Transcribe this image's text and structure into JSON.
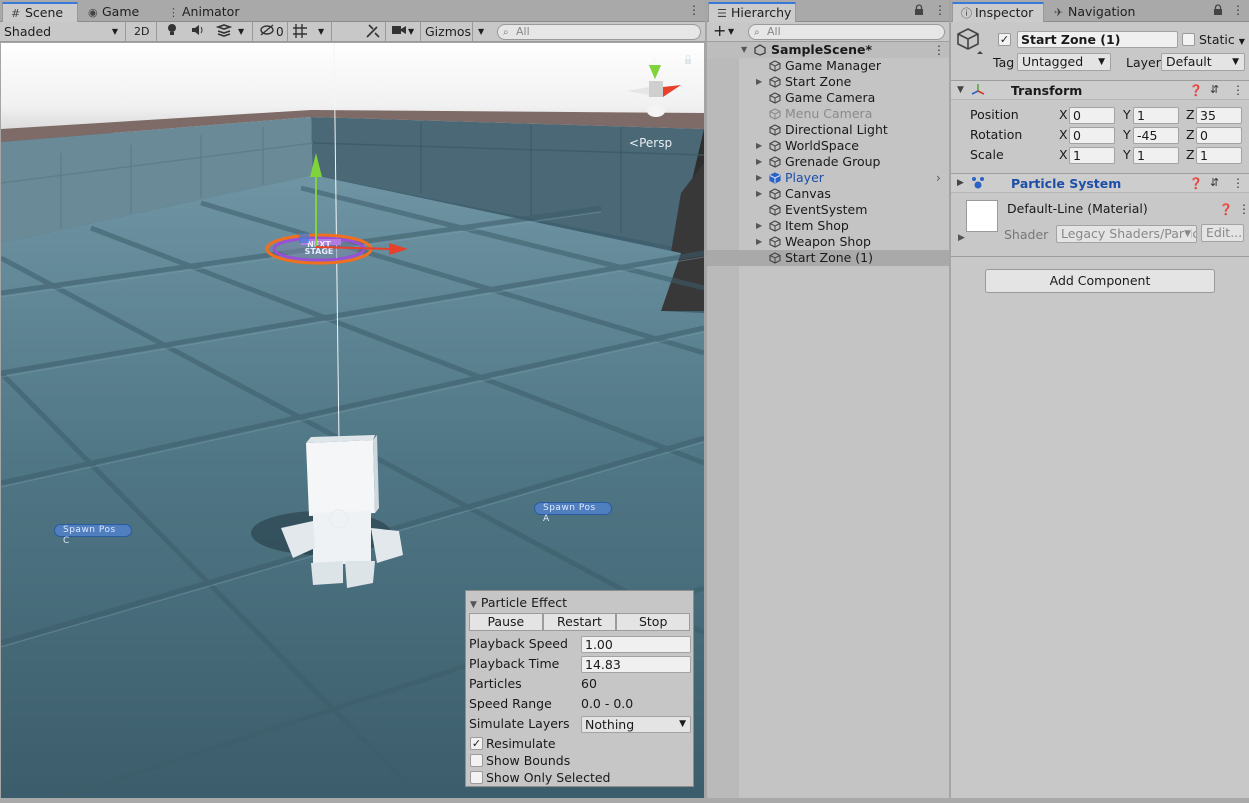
{
  "scene_panel": {
    "tabs": [
      {
        "label": "Scene",
        "icon": "hash-icon",
        "active": true
      },
      {
        "label": "Game",
        "icon": "gamepad-icon",
        "active": false
      },
      {
        "label": "Animator",
        "icon": "animator-icon",
        "active": false
      }
    ],
    "toolbar": {
      "shading_mode": "Shaded",
      "toggle_2d": "2D",
      "hidden_count": "0",
      "gizmos_label": "Gizmos",
      "search_placeholder": "All"
    },
    "viewport": {
      "persp_label": "Persp",
      "gizmo_axes": {
        "y": "y",
        "x": "x"
      },
      "spawn_labels": [
        "Spawn Pos C",
        "Spawn Pos A"
      ],
      "zone_label": "NEXT STAGE"
    },
    "particle_effect": {
      "title": "Particle Effect",
      "buttons": [
        "Pause",
        "Restart",
        "Stop"
      ],
      "playback_speed_label": "Playback Speed",
      "playback_speed": "1.00",
      "playback_time_label": "Playback Time",
      "playback_time": "14.83",
      "particles_label": "Particles",
      "particles": "60",
      "speed_range_label": "Speed Range",
      "speed_range": "0.0 - 0.0",
      "simulate_layers_label": "Simulate Layers",
      "simulate_layers": "Nothing",
      "resimulate_label": "Resimulate",
      "resimulate": true,
      "show_bounds_label": "Show Bounds",
      "show_bounds": false,
      "show_only_selected_label": "Show Only Selected",
      "show_only_selected": false
    }
  },
  "hierarchy": {
    "tab_label": "Hierarchy",
    "search_placeholder": "All",
    "scene_name": "SampleScene*",
    "items": [
      {
        "label": "Game Manager",
        "expandable": false,
        "dimmed": false,
        "highlight": false,
        "selected": false
      },
      {
        "label": "Start Zone",
        "expandable": true,
        "dimmed": false,
        "highlight": false,
        "selected": false
      },
      {
        "label": "Game Camera",
        "expandable": false,
        "dimmed": false,
        "highlight": false,
        "selected": false
      },
      {
        "label": "Menu Camera",
        "expandable": false,
        "dimmed": true,
        "highlight": false,
        "selected": false
      },
      {
        "label": "Directional Light",
        "expandable": false,
        "dimmed": false,
        "highlight": false,
        "selected": false
      },
      {
        "label": "WorldSpace",
        "expandable": true,
        "dimmed": false,
        "highlight": false,
        "selected": false
      },
      {
        "label": "Grenade Group",
        "expandable": true,
        "dimmed": false,
        "highlight": false,
        "selected": false
      },
      {
        "label": "Player",
        "expandable": true,
        "dimmed": false,
        "highlight": true,
        "selected": false
      },
      {
        "label": "Canvas",
        "expandable": true,
        "dimmed": false,
        "highlight": false,
        "selected": false
      },
      {
        "label": "EventSystem",
        "expandable": false,
        "dimmed": false,
        "highlight": false,
        "selected": false
      },
      {
        "label": "Item Shop",
        "expandable": true,
        "dimmed": false,
        "highlight": false,
        "selected": false
      },
      {
        "label": "Weapon Shop",
        "expandable": true,
        "dimmed": false,
        "highlight": false,
        "selected": false
      },
      {
        "label": "Start Zone (1)",
        "expandable": false,
        "dimmed": false,
        "highlight": false,
        "selected": true
      }
    ]
  },
  "inspector": {
    "tabs": [
      {
        "label": "Inspector",
        "icon": "info-icon",
        "active": true
      },
      {
        "label": "Navigation",
        "icon": "navigation-icon",
        "active": false
      }
    ],
    "object_name": "Start Zone (1)",
    "active": true,
    "static_label": "Static",
    "tag_label": "Tag",
    "tag_value": "Untagged",
    "layer_label": "Layer",
    "layer_value": "Default",
    "transform": {
      "title": "Transform",
      "position_label": "Position",
      "rotation_label": "Rotation",
      "scale_label": "Scale",
      "position": {
        "x": "0",
        "y": "1",
        "z": "35"
      },
      "rotation": {
        "x": "0",
        "y": "-45",
        "z": "0"
      },
      "scale": {
        "x": "1",
        "y": "1",
        "z": "1"
      },
      "axis_x": "X",
      "axis_y": "Y",
      "axis_z": "Z"
    },
    "particle_system": {
      "title": "Particle System"
    },
    "material": {
      "name": "Default-Line (Material)",
      "shader_label": "Shader",
      "shader_value": "Legacy Shaders/Partic",
      "edit_label": "Edit..."
    },
    "add_component_label": "Add Component"
  },
  "colors": {
    "accent": "#3a79d8",
    "zone_orange": "#f07020",
    "zone_purple": "#9b4fd6",
    "gizmo_green": "#7ed43a",
    "gizmo_red": "#e8402a",
    "player_blue": "#2b63c4"
  }
}
